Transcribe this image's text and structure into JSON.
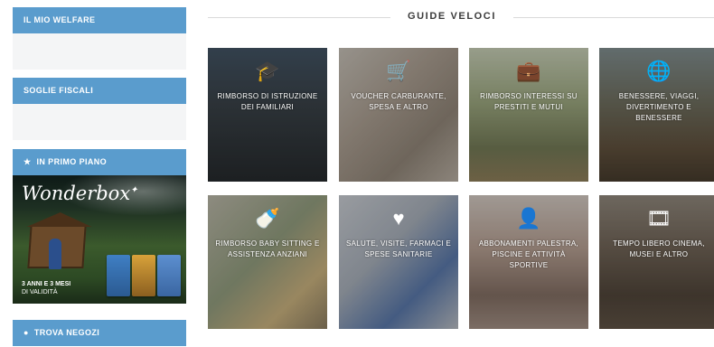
{
  "sidebar": {
    "sections": [
      {
        "label": "IL MIO WELFARE"
      },
      {
        "label": "SOGLIE FISCALI"
      },
      {
        "label": "IN PRIMO PIANO",
        "icon": "pin-icon"
      },
      {
        "label": "TROVA NEGOZI",
        "icon": "location-icon"
      }
    ],
    "promo": {
      "brand": "Wonderbox",
      "brand_sub": "",
      "text_line1": "3 ANNI E 3 MESI",
      "text_line2": "DI VALIDITÀ"
    }
  },
  "main": {
    "title": "GUIDE VELOCI",
    "tiles": [
      {
        "label": "RIMBORSO DI ISTRUZIONE DEI FAMILIARI",
        "icon": "graduation-cap-icon"
      },
      {
        "label": "VOUCHER CARBURANTE, SPESA E ALTRO",
        "icon": "shopping-cart-icon"
      },
      {
        "label": "RIMBORSO INTERESSI SU PRESTITI E MUTUI",
        "icon": "briefcase-icon"
      },
      {
        "label": "BENESSERE, VIAGGI, DIVERTIMENTO E BENESSERE",
        "icon": "globe-icon"
      },
      {
        "label": "RIMBORSO BABY SITTING E ASSISTENZA ANZIANI",
        "icon": "baby-bottle-icon"
      },
      {
        "label": "SALUTE, VISITE, FARMACI E SPESE SANITARIE",
        "icon": "heart-icon"
      },
      {
        "label": "ABBONAMENTI PALESTRA, PISCINE E ATTIVITÀ SPORTIVE",
        "icon": "person-icon"
      },
      {
        "label": "TEMPO LIBERO CINEMA, MUSEI E ALTRO",
        "icon": "film-icon"
      }
    ]
  },
  "colors": {
    "accent": "#5a9ccd",
    "panel": "#f4f5f6"
  }
}
